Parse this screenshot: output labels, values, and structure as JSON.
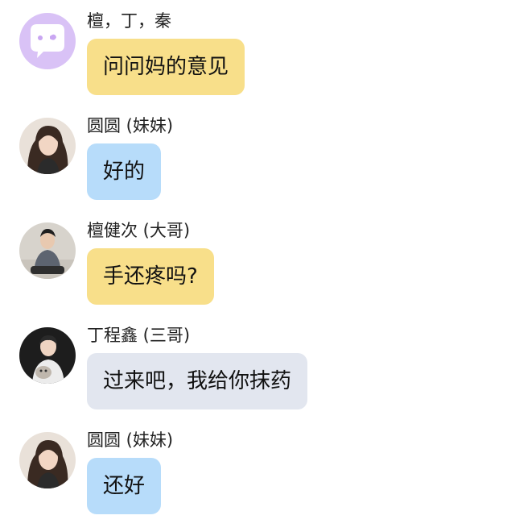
{
  "colors": {
    "bubble_yellow": "#f8df8a",
    "bubble_blue": "#b7dcfa",
    "bubble_gray": "#e2e6ef",
    "avatar_lavender": "#d9c2f6"
  },
  "messages": [
    {
      "sender": "檀，丁，秦",
      "text": "问问妈的意见",
      "bubble_color": "#f8df8a",
      "avatar_icon": "chat-bubble-icon"
    },
    {
      "sender": "圆圆 (妹妹)",
      "text": "好的",
      "bubble_color": "#b7dcfa",
      "avatar_icon": "girl-photo-avatar"
    },
    {
      "sender": "檀健次 (大哥)",
      "text": "手还疼吗?",
      "bubble_color": "#f8df8a",
      "avatar_icon": "man-sitting-photo-avatar"
    },
    {
      "sender": "丁程鑫 (三哥)",
      "text": "过来吧，我给你抹药",
      "bubble_color": "#e2e6ef",
      "avatar_icon": "man-holding-cat-photo-avatar"
    },
    {
      "sender": "圆圆 (妹妹)",
      "text": "还好",
      "bubble_color": "#b7dcfa",
      "avatar_icon": "girl-photo-avatar"
    }
  ]
}
